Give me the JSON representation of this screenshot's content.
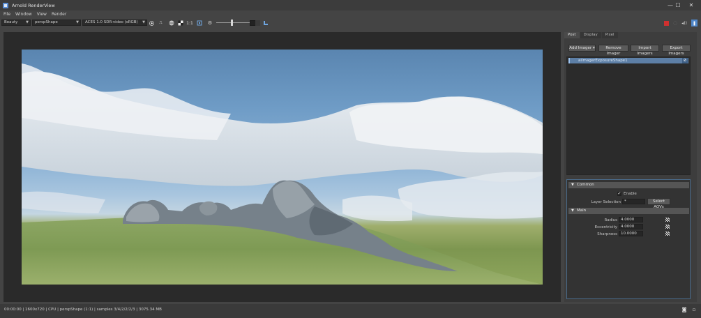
{
  "window": {
    "title": "Arnold RenderView",
    "controls": [
      "—",
      "☐",
      "✕"
    ]
  },
  "menu": [
    "File",
    "Window",
    "View",
    "Render"
  ],
  "toolbar": {
    "aov": "Beauty",
    "camera": "perspShape",
    "view_transform": "ACES 1.0 SDR-video (sRGB)",
    "ratio_label": "1:1",
    "icons": [
      "display-dot-icon",
      "lut-icon",
      "exposure-icon",
      "channels-icon",
      "crop-icon",
      "settings-gear-icon",
      "snapshot-icon",
      "stop-icon",
      "ipr-refresh-icon",
      "audio-icon",
      "panel-toggle-icon"
    ],
    "exposure_value": 0.4
  },
  "panel": {
    "tabs": [
      "Post",
      "Display",
      "Pixel"
    ],
    "active_tab": "Post",
    "buttons": {
      "add": "Add Imager",
      "remove": "Remove Imager",
      "import": "Import Imagers",
      "export": "Export Imagers"
    },
    "imager_row": "aiImagerExposureShape1",
    "common": {
      "title": "Common",
      "enable_label": "Enable",
      "enable_checked": true,
      "layer_label": "Layer Selection",
      "layer_value": "*",
      "select_aovs": "Select AOVs"
    },
    "main": {
      "title": "Main",
      "radius_label": "Radius",
      "radius_value": "4.0000",
      "eccentricity_label": "Eccentricity",
      "eccentricity_value": "4.0000",
      "sharpness_label": "Sharpness",
      "sharpness_value": "10.0000"
    }
  },
  "status": {
    "text": "00:00:00 | 1600x720 | CPU | perspShape (1:1) | samples 3/4/2/2/2/3 | 3075.34 MB"
  },
  "colors": {
    "accent": "#5d7fa6",
    "stop": "#d0302f",
    "background": "#444444"
  }
}
